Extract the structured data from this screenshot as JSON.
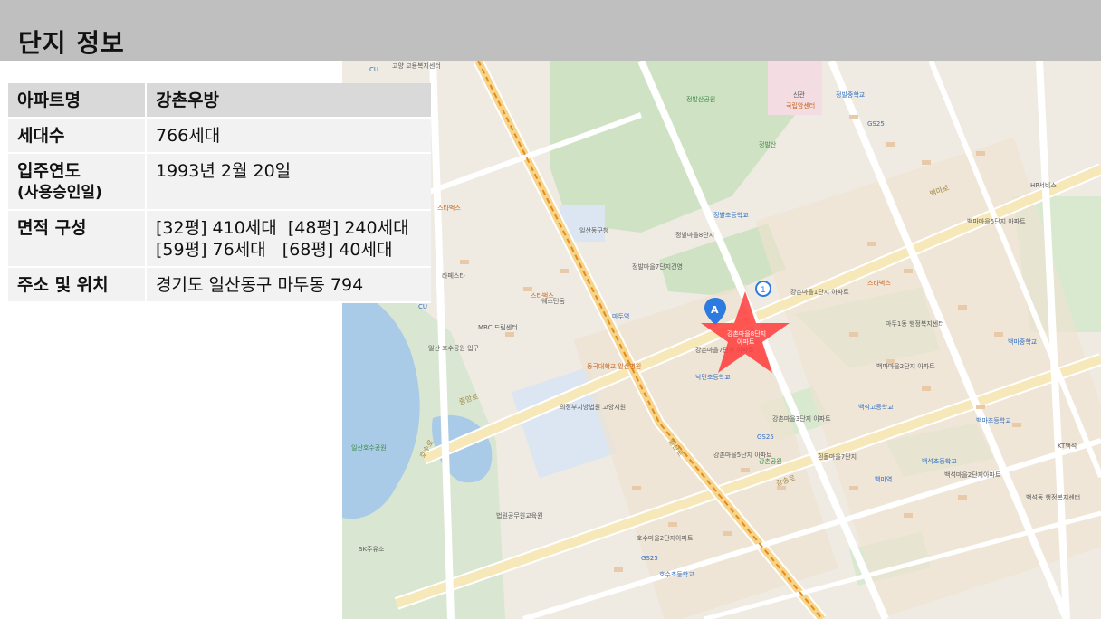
{
  "page": {
    "title": "단지 정보"
  },
  "info_table": {
    "rows": [
      {
        "key": "아파트명",
        "value": "강촌우방"
      },
      {
        "key": "세대수",
        "value": "766세대"
      },
      {
        "key_line1": "입주연도",
        "key_line2": "(사용승인일)",
        "value": "1993년 2월 20일"
      },
      {
        "key": "면적 구성",
        "value_line1": "[32평] 410세대  [48평] 240세대",
        "value_line2": "[59평] 76세대   [68평] 40세대"
      },
      {
        "key": "주소 및 위치",
        "value": "경기도 일산동구 마두동 794"
      }
    ]
  },
  "map": {
    "marker_a": "A",
    "marker_1": "1",
    "target_label_1": "강촌마을8단지",
    "target_label_2": "아파트",
    "accent_color": "#ff3b3b",
    "labels": {
      "poi_1": "신관",
      "poi_2": "국립암센터",
      "poi_3": "정발중학교",
      "poi_4": "정발산공원",
      "poi_5": "정발산",
      "poi_6": "일산동구청",
      "poi_7": "정발초등학교",
      "poi_8": "마두역",
      "poi_9": "낙민초등학교",
      "poi_10": "백석고등학교",
      "poi_11": "일산호수공원",
      "poi_12": "MBC 드림센터",
      "poi_13": "의정부지방법원 고양지원",
      "poi_14": "동국대학교 일산병원",
      "poi_15": "백마초등학교",
      "poi_16": "HP서비스",
      "poi_17": "백마역",
      "poi_18": "호수초등학교",
      "poi_19": "강촌공원",
      "poi_20": "백석초등학교",
      "poi_21": "백마중학교",
      "poi_22": "강촌마을1단지 아파트",
      "poi_23": "강촌마을7단지 아파트",
      "poi_24": "백마마을2단지 아파트",
      "poi_25": "백마마을5단지 아파트",
      "poi_26": "강촌마을3단지 아파트",
      "poi_27": "강촌마을5단지 아파트",
      "poi_28": "정발마을7단지건영",
      "poi_29": "정발마을8단지",
      "poi_30": "호수마을2단지아파트",
      "poi_31": "흰돌마을7단지",
      "poi_32": "백석마을2단지아파트",
      "poi_33": "고양 고용복지센터",
      "poi_34": "웨스턴돔",
      "poi_35": "라페스타",
      "poi_36": "일산 호수공원 입구",
      "poi_37": "법원공무원교육원",
      "poi_38": "SK주유소",
      "poi_39": "마두1동 행정복지센터",
      "poi_40": "백석동 행정복지센터",
      "poi_41": "KT백석",
      "poi_42": "GS25",
      "poi_43": "CU",
      "poi_44": "스타벅스",
      "road_1": "중앙로",
      "road_2": "호수로",
      "road_3": "일산로",
      "road_4": "백마로",
      "road_5": "강송로"
    }
  }
}
